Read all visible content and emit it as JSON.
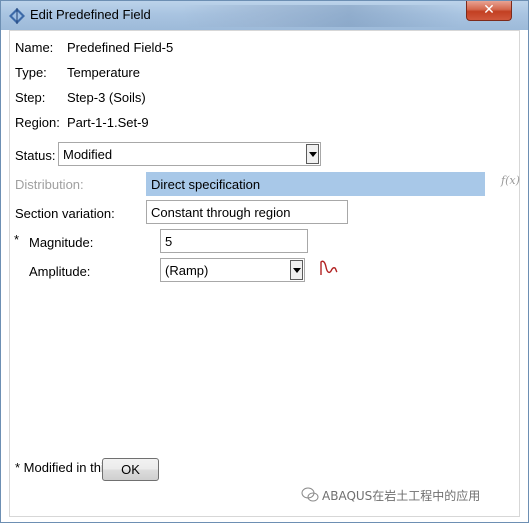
{
  "window": {
    "title": "Edit Predefined Field",
    "close_label": "✕"
  },
  "info": {
    "name_label": "Name:",
    "name_value": "Predefined Field-5",
    "type_label": "Type:",
    "type_value": "Temperature",
    "step_label": "Step:",
    "step_value": "Step-3 (Soils)",
    "region_label": "Region:",
    "region_value": "Part-1-1.Set-9"
  },
  "status": {
    "label": "Status:",
    "value": "Modified"
  },
  "distribution": {
    "label": "Distribution:",
    "value": "Direct specification",
    "fx_label": "f(x)"
  },
  "section_variation": {
    "label": "Section variation:",
    "value": "Constant through region"
  },
  "magnitude": {
    "asterisk": "*",
    "label": "Magnitude:",
    "value": "5"
  },
  "amplitude": {
    "label": "Amplitude:",
    "value": "(Ramp)"
  },
  "footer": {
    "note": "* Modified in this step",
    "ok_label": "OK",
    "watermark": "ABAQUS在岩土工程中的应用"
  },
  "colors": {
    "title_bar": "#a9c4e1",
    "close_button": "#c23f22",
    "selection_blue": "#a8c8e8",
    "amplitude_icon": "#b22222"
  }
}
